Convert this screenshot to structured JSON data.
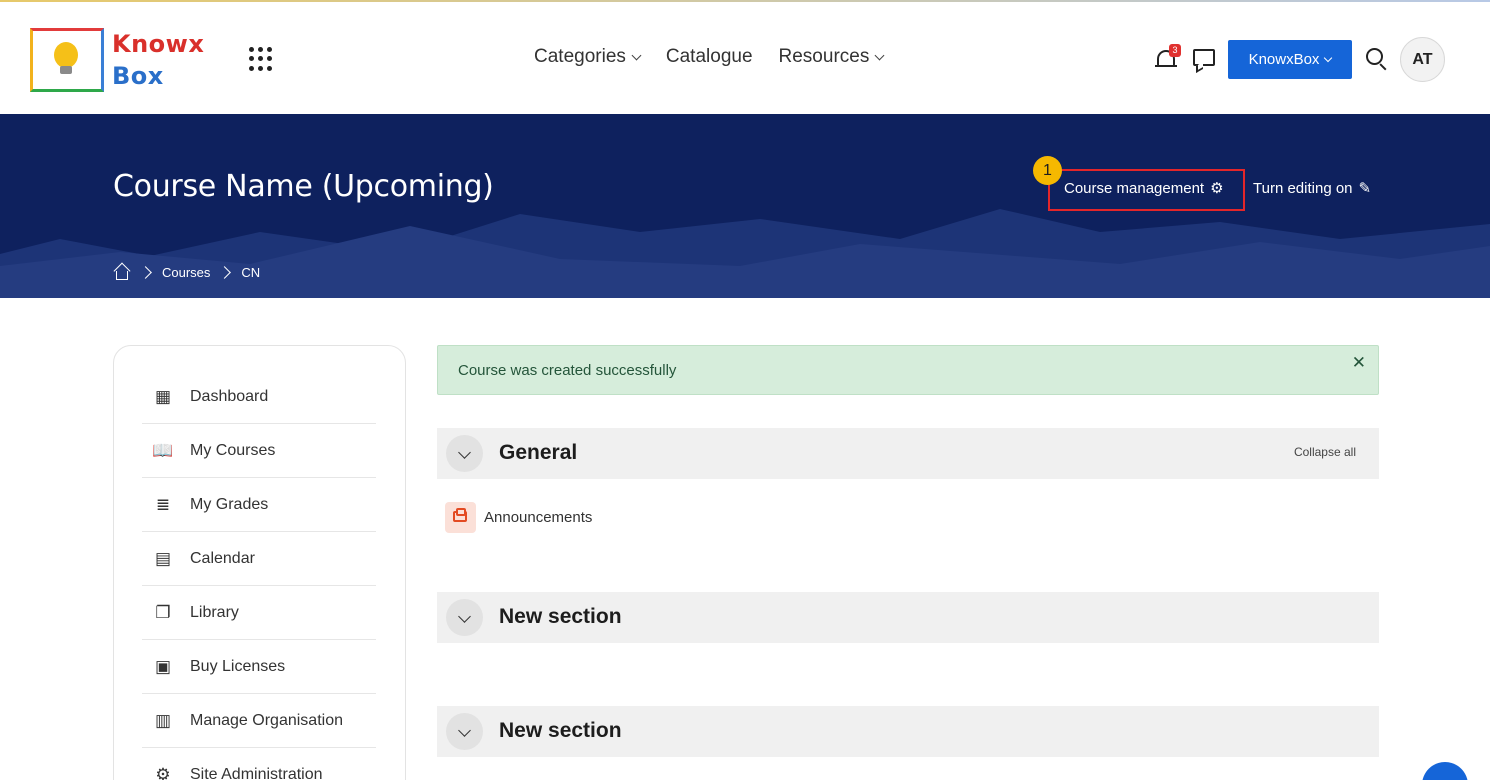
{
  "header": {
    "logo_line1": "Knowx",
    "logo_line2": "Box",
    "nav": [
      {
        "label": "Categories"
      },
      {
        "label": "Catalogue"
      },
      {
        "label": "Resources"
      }
    ],
    "notification_count": "3",
    "org_button": "KnowxBox",
    "avatar_initials": "AT"
  },
  "hero": {
    "title": "Course Name (Upcoming)",
    "course_management": "Course management",
    "turn_editing": "Turn editing on",
    "step_badge": "1",
    "breadcrumb": [
      "Courses",
      "CN"
    ]
  },
  "sidebar": {
    "items": [
      {
        "label": "Dashboard",
        "icon": "dashboard-icon"
      },
      {
        "label": "My Courses",
        "icon": "book-icon"
      },
      {
        "label": "My Grades",
        "icon": "grades-icon"
      },
      {
        "label": "Calendar",
        "icon": "calendar-icon"
      },
      {
        "label": "Library",
        "icon": "library-icon"
      },
      {
        "label": "Buy Licenses",
        "icon": "money-icon"
      },
      {
        "label": "Manage Organisation",
        "icon": "organisation-icon"
      },
      {
        "label": "Site Administration",
        "icon": "admin-gear-icon"
      }
    ]
  },
  "main": {
    "alert": "Course was created successfully",
    "collapse_all": "Collapse all",
    "sections": [
      {
        "title": "General"
      },
      {
        "title": "New section"
      },
      {
        "title": "New section"
      }
    ],
    "activity": "Announcements"
  },
  "colors": {
    "hero_bg": "#0e215e",
    "primary_button": "#1565d8",
    "alert_bg": "#d6eddb",
    "highlight": "#e3262a",
    "badge": "#f5b800"
  }
}
